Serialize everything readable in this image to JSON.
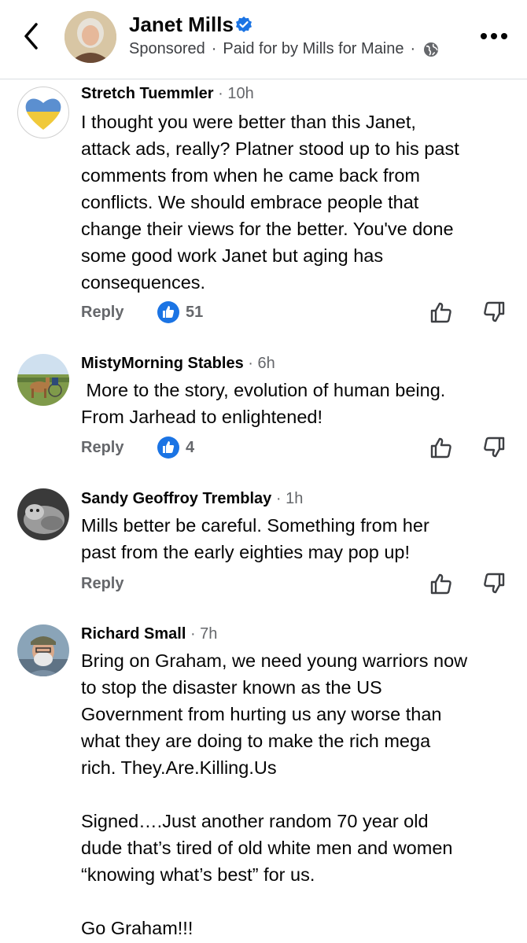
{
  "header": {
    "name": "Janet Mills",
    "sponsored": "Sponsored",
    "paid_for": "Paid for by Mills for Maine"
  },
  "comments": [
    {
      "author": "Stretch Tuemmler",
      "time": "10h",
      "text": "I thought you were better than this Janet,\nattack ads, really?  Platner stood up to his past\ncomments from when he came back from\nconflicts.  We should embrace people that\nchange their views for the better.  You've done\nsome good work Janet but aging has\nconsequences.",
      "reply_label": "Reply",
      "likes": "51"
    },
    {
      "author": "MistyMorning Stables",
      "time": "6h",
      "text": " More to the story, evolution of human being.\nFrom Jarhead to enlightened!",
      "reply_label": "Reply",
      "likes": "4"
    },
    {
      "author": "Sandy Geoffroy Tremblay",
      "time": "1h",
      "text": "Mills better be careful. Something from her\npast from the early eighties may pop up!",
      "reply_label": "Reply"
    },
    {
      "author": "Richard Small",
      "time": "7h",
      "text": "Bring on Graham, we need young warriors now\nto stop the disaster known as the US\nGovernment from hurting us any worse than\nwhat they are doing to make the rich mega\nrich. They.Are.Killing.Us\n\nSigned….Just another random 70 year old\ndude that’s tired of old white men and women\n“knowing what’s best” for us.\n\nGo Graham!!!"
    }
  ],
  "colors": {
    "accent": "#1b74e4",
    "secondary_text": "#65676b",
    "divider": "#dadde1"
  },
  "icons": [
    "back-arrow-icon",
    "verified-badge-icon",
    "globe-icon",
    "more-options-icon",
    "like-reaction-icon",
    "thumbs-up-icon",
    "thumbs-down-icon"
  ]
}
